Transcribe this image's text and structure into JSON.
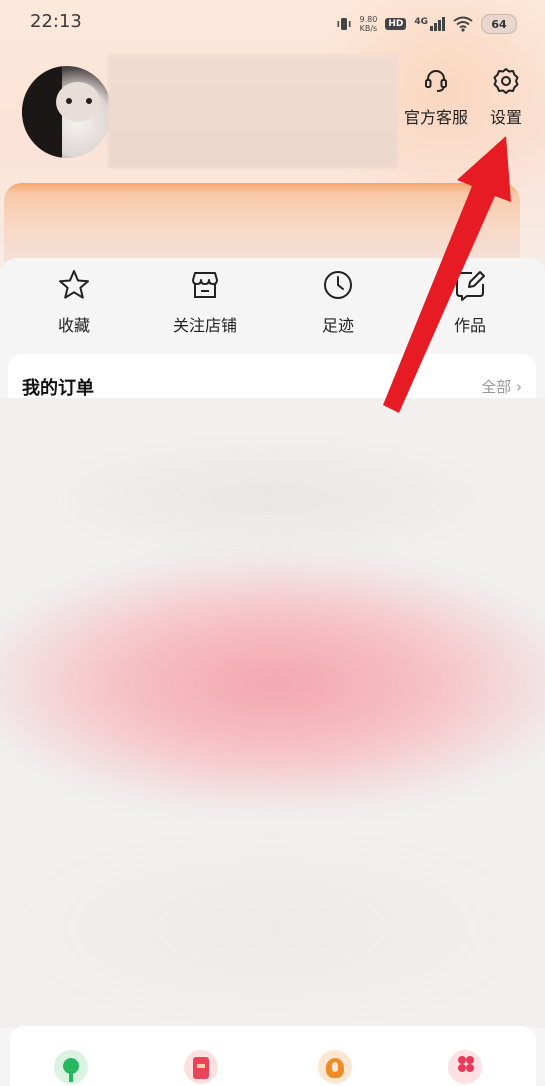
{
  "status_bar": {
    "time": "22:13",
    "net_speed_value": "9.80",
    "net_speed_unit": "KB/s",
    "hd_label": "HD",
    "network_type": "4G",
    "battery": "64"
  },
  "header": {
    "service_label": "官方客服",
    "settings_label": "设置"
  },
  "quick_actions": [
    {
      "label": "收藏",
      "icon": "star-icon"
    },
    {
      "label": "关注店铺",
      "icon": "store-icon"
    },
    {
      "label": "足迹",
      "icon": "clock-icon"
    },
    {
      "label": "作品",
      "icon": "edit-icon"
    }
  ],
  "orders": {
    "title": "我的订单",
    "all_label": "全部",
    "all_chevron": "›"
  },
  "bottom_services": [
    {
      "icon": "green-service-icon",
      "color": "#27b85f"
    },
    {
      "icon": "red-envelope-icon",
      "color": "#e9445a"
    },
    {
      "icon": "orange-service-icon",
      "color": "#f08a24"
    },
    {
      "icon": "flower-icon",
      "color": "#e8385a"
    }
  ],
  "colors": {
    "arrow": "#e61b23",
    "accent_orange": "#f6a56b"
  }
}
